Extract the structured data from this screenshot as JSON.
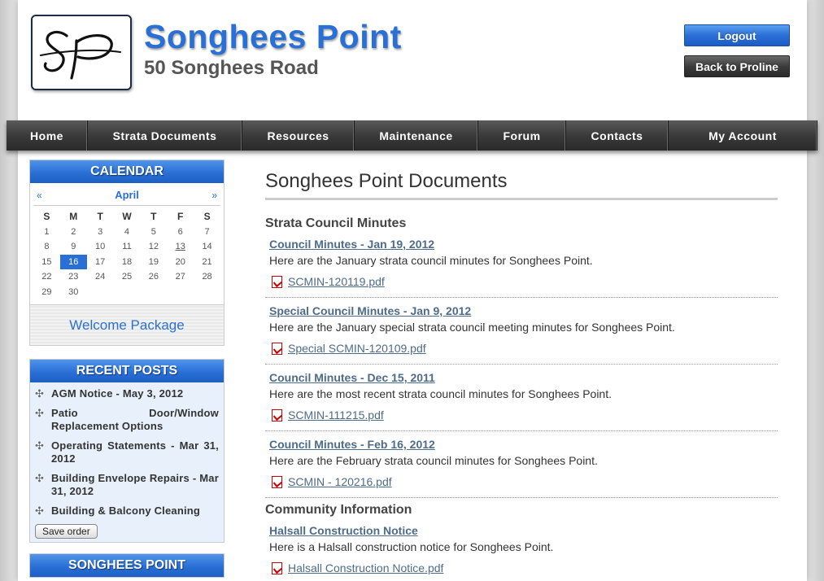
{
  "header": {
    "logo_text": "SP",
    "title": "Songhees Point",
    "subtitle": "50 Songhees Road",
    "logout_label": "Logout",
    "back_label": "Back to Proline"
  },
  "nav": [
    {
      "label": "Home"
    },
    {
      "label": "Strata Documents"
    },
    {
      "label": "Resources"
    },
    {
      "label": "Maintenance"
    },
    {
      "label": "Forum"
    },
    {
      "label": "Contacts"
    },
    {
      "label": "My Account"
    }
  ],
  "calendar": {
    "title": "CALENDAR",
    "prev": "«",
    "next": "»",
    "month": "April",
    "weekdays": [
      "S",
      "M",
      "T",
      "W",
      "T",
      "F",
      "S"
    ],
    "days": [
      "1",
      "2",
      "3",
      "4",
      "5",
      "6",
      "7",
      "8",
      "9",
      "10",
      "11",
      "12",
      "13",
      "14",
      "15",
      "16",
      "17",
      "18",
      "19",
      "20",
      "21",
      "22",
      "23",
      "24",
      "25",
      "26",
      "27",
      "28",
      "29",
      "30"
    ],
    "today": "16",
    "linked": "13"
  },
  "welcome_label": "Welcome Package",
  "recent_posts": {
    "title": "RECENT POSTS",
    "items": [
      "AGM Notice - May 3, 2012",
      "Patio Door/Window Replacement Options",
      "Operating Statements - Mar 31, 2012",
      "Building Envelope Repairs - Mar 31, 2012",
      "Building & Balcony Cleaning"
    ],
    "save_label": "Save order"
  },
  "third_box_title": "SONGHEES POINT",
  "main": {
    "heading": "Songhees Point Documents",
    "sections": [
      {
        "title": "Strata Council Minutes",
        "docs": [
          {
            "title": "Council Minutes - Jan 19, 2012",
            "desc": "Here are the January strata council minutes for Songhees Point.",
            "file": "SCMIN-120119.pdf"
          },
          {
            "title": "Special Council Minutes - Jan 9, 2012",
            "desc": "Here are the January special strata council meeting minutes for Songhees Point.",
            "file": "Special SCMIN-120109.pdf"
          },
          {
            "title": "Council Minutes - Dec 15, 2011",
            "desc": "Here are the most recent strata council minutes for Songhees Point.",
            "file": "SCMIN-111215.pdf"
          },
          {
            "title": "Council Minutes - Feb 16, 2012",
            "desc": "Here are the February strata council minutes for Songhees Point.",
            "file": "SCMIN - 120216.pdf"
          }
        ]
      },
      {
        "title": "Community Information",
        "docs": [
          {
            "title": "Halsall Construction Notice",
            "desc": "Here is a Halsall construction notice for Songhees Point.",
            "file": "Halsall Construction Notice.pdf"
          }
        ]
      }
    ]
  },
  "colors": {
    "accent": "#2a6fd6",
    "nav_bg": "#3a3a3a",
    "link": "#4d6b8a"
  }
}
